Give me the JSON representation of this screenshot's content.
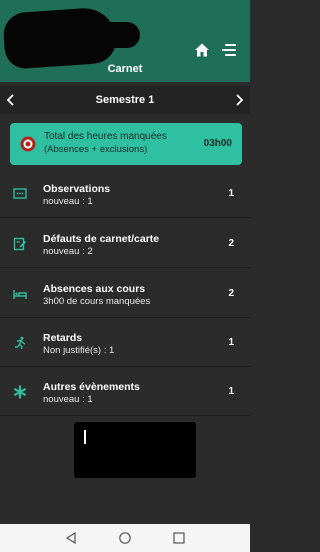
{
  "header": {
    "title": "Carnet",
    "home_icon": "home-icon",
    "menu_icon": "menu-icon",
    "colors": {
      "header_bg": "#1f6e58",
      "accent": "#2fbfa1"
    }
  },
  "semester": {
    "label": "Semestre 1",
    "prev_icon": "chevron-left-icon",
    "next_icon": "chevron-right-icon"
  },
  "total": {
    "title": "Total des heures manquées",
    "subtitle": "(Absences + exclusions)",
    "value": "03h00",
    "icon": "target-icon"
  },
  "rows": [
    {
      "title": "Observations",
      "subtitle": "nouveau : 1",
      "count": "1",
      "icon": "comment-icon"
    },
    {
      "title": "Défauts de carnet/carte",
      "subtitle": "nouveau : 2",
      "count": "2",
      "icon": "card-edit-icon"
    },
    {
      "title": "Absences aux cours",
      "subtitle": "3h00 de cours manquées",
      "count": "2",
      "icon": "bed-icon"
    },
    {
      "title": "Retards",
      "subtitle": "Non justifié(s) : 1",
      "count": "1",
      "icon": "running-icon"
    },
    {
      "title": "Autres évènements",
      "subtitle": "nouveau : 1",
      "count": "1",
      "icon": "asterisk-icon"
    }
  ],
  "navbar": {
    "back_icon": "nav-back-icon",
    "home_icon": "nav-home-icon",
    "recent_icon": "nav-recent-icon"
  }
}
